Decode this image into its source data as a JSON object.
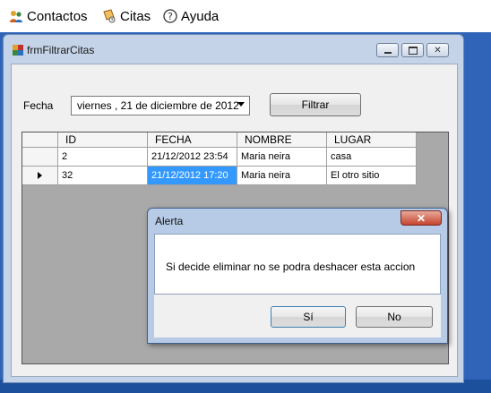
{
  "menu": {
    "items": [
      {
        "label": "Contactos",
        "icon": "people-icon"
      },
      {
        "label": "Citas",
        "icon": "calendar-icon"
      },
      {
        "label": "Ayuda",
        "icon": "help-icon"
      }
    ]
  },
  "window": {
    "title": "frmFiltrarCitas",
    "fecha_label": "Fecha",
    "date_value": "viernes  , 21 de  diciembre  de 2012",
    "filter_button": "Filtrar"
  },
  "grid": {
    "columns": [
      "ID",
      "FECHA",
      "NOMBRE",
      "LUGAR"
    ],
    "rows": [
      {
        "id": "2",
        "fecha": "21/12/2012 23:54",
        "nombre": "Maria neira",
        "lugar": "casa"
      },
      {
        "id": "32",
        "fecha": "21/12/2012 17:20",
        "nombre": "Maria neira",
        "lugar": "El otro sitio"
      }
    ]
  },
  "dialog": {
    "title": "Alerta",
    "message": "Si decide eliminar no se podra deshacer esta accion",
    "yes": "Sí",
    "no": "No"
  },
  "colors": {
    "selection": "#3399ff",
    "desktop": "#2f64b8",
    "close_button": "#c6442e"
  }
}
